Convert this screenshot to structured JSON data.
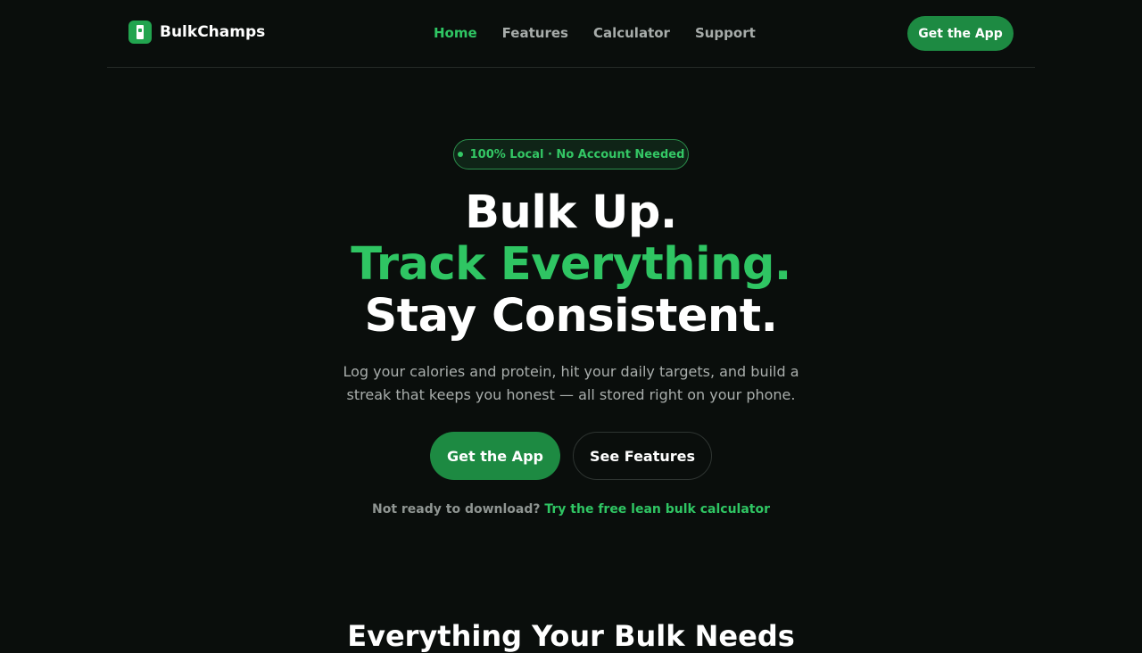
{
  "brand": {
    "name": "BulkChamps",
    "logo_icon": "phone-logo-icon"
  },
  "nav": {
    "links": [
      {
        "label": "Home",
        "active": true
      },
      {
        "label": "Features",
        "active": false
      },
      {
        "label": "Calculator",
        "active": false
      },
      {
        "label": "Support",
        "active": false
      }
    ],
    "cta_label": "Get the App"
  },
  "hero": {
    "badge": "100% Local · No Account Needed",
    "headline_line1": "Bulk Up.",
    "headline_line2": "Track Everything.",
    "headline_line3": "Stay Consistent.",
    "subtext": "Log your calories and protein, hit your daily targets, and build a streak that keeps you honest — all stored right on your phone.",
    "primary_button": "Get the App",
    "secondary_button": "See Features",
    "calculator_prompt": "Not ready to download?",
    "calculator_link": "Try the free lean bulk calculator"
  },
  "features_section": {
    "title": "Everything Your Bulk Needs"
  },
  "colors": {
    "background": "#0a0e0c",
    "accent": "#2fc563",
    "button": "#1d8a42",
    "muted_text": "#a9aeac"
  }
}
